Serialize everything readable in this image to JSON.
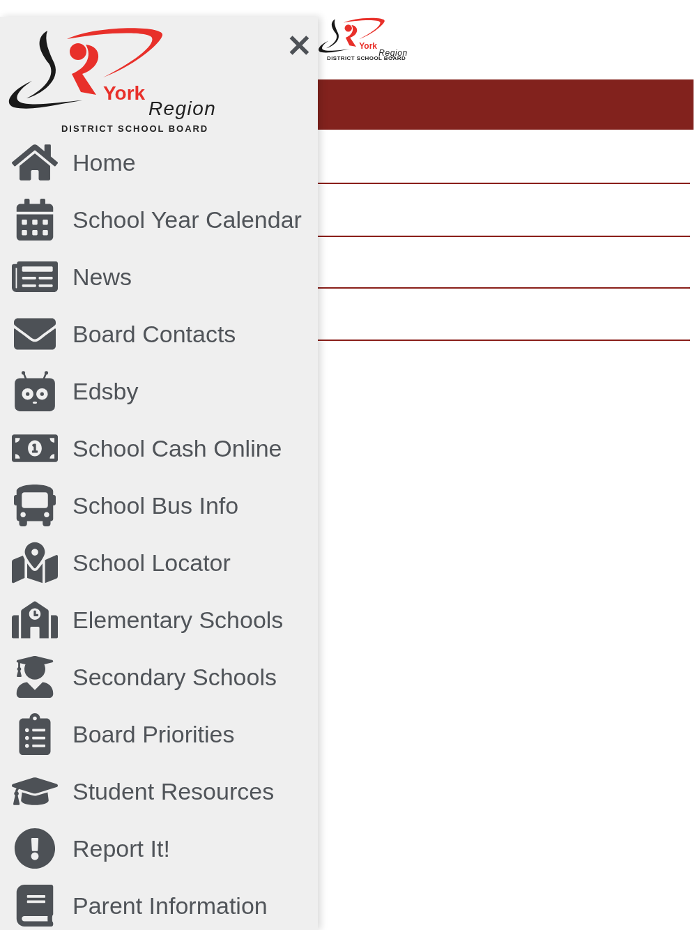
{
  "page_logo": {
    "name": "York",
    "sub": "Region",
    "tagline": "DISTRICT SCHOOL BOARD"
  },
  "drawer": {
    "logo": {
      "name": "York",
      "sub": "Region",
      "tagline": "DISTRICT SCHOOL BOARD"
    },
    "close": "✕",
    "items": [
      {
        "label": "Home"
      },
      {
        "label": "School Year Calendar"
      },
      {
        "label": "News"
      },
      {
        "label": "Board Contacts"
      },
      {
        "label": "Edsby"
      },
      {
        "label": "School Cash Online"
      },
      {
        "label": "School Bus Info"
      },
      {
        "label": "School Locator"
      },
      {
        "label": "Elementary Schools"
      },
      {
        "label": "Secondary Schools"
      },
      {
        "label": "Board Priorities"
      },
      {
        "label": "Student Resources"
      },
      {
        "label": "Report It!"
      },
      {
        "label": "Parent Information"
      }
    ]
  }
}
